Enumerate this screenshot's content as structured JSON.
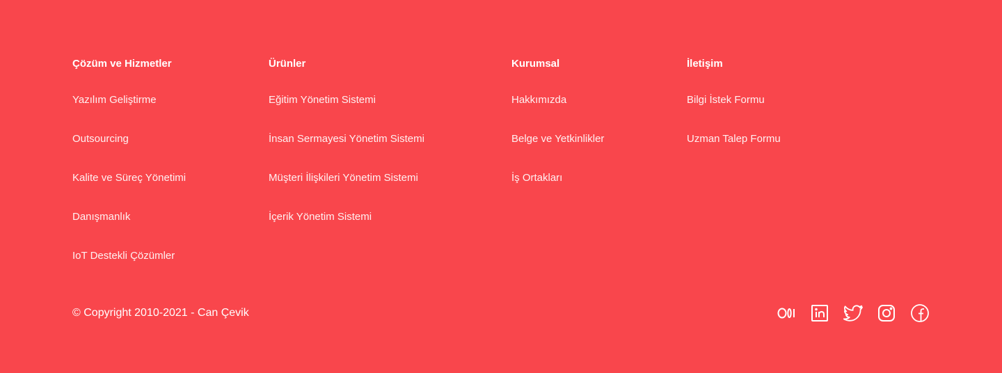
{
  "footer": {
    "columns": [
      {
        "title": "Çözüm ve Hizmetler",
        "links": [
          "Yazılım Geliştirme",
          "Outsourcing",
          "Kalite ve Süreç Yönetimi",
          "Danışmanlık",
          "IoT Destekli Çözümler"
        ]
      },
      {
        "title": "Ürünler",
        "links": [
          "Eğitim Yönetim Sistemi",
          "İnsan Sermayesi Yönetim Sistemi",
          "Müşteri İlişkileri Yönetim Sistemi",
          "İçerik Yönetim Sistemi"
        ]
      },
      {
        "title": "Kurumsal",
        "links": [
          "Hakkımızda",
          "Belge ve Yetkinlikler",
          "İş Ortakları"
        ]
      },
      {
        "title": "İletişim",
        "links": [
          "Bilgi İstek Formu",
          "Uzman Talep Formu"
        ]
      }
    ],
    "copyright": "© Copyright 2010-2021 - Can Çevik",
    "social_icons": [
      "medium-icon",
      "linkedin-icon",
      "twitter-icon",
      "instagram-icon",
      "facebook-icon"
    ]
  },
  "colors": {
    "background": "#f9464c",
    "text": "#ffffff"
  }
}
